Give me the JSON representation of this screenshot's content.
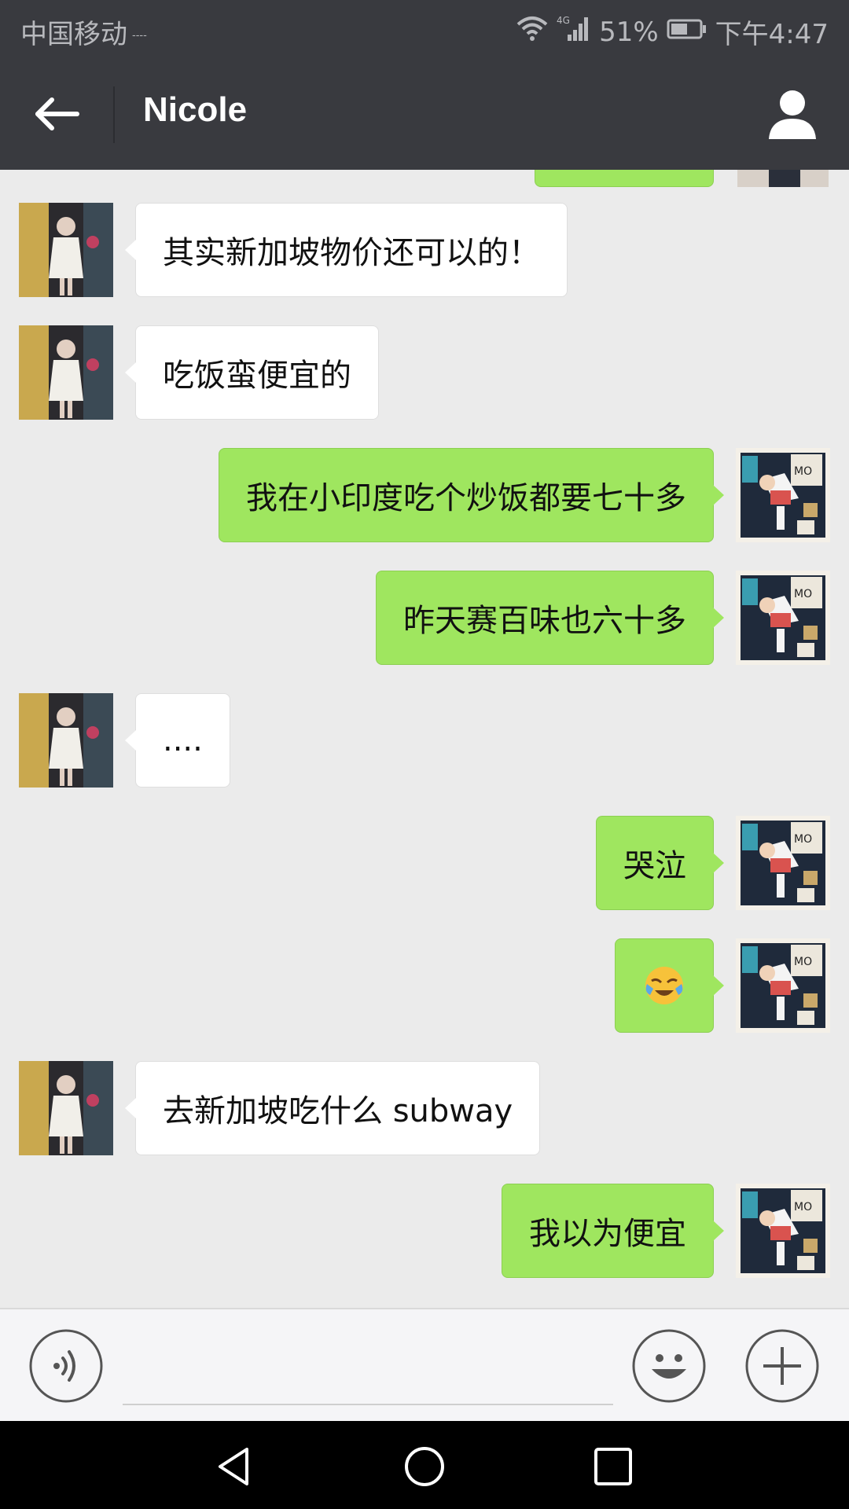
{
  "status_bar": {
    "carrier": "中国移动",
    "carrier_extra": "----",
    "network": "4G",
    "battery": "51%",
    "time": "下午4:47"
  },
  "header": {
    "title": "Nicole",
    "back_icon": "arrow-left-icon",
    "profile_icon": "person-icon"
  },
  "messages": [
    {
      "side": "left",
      "text": "其实新加坡物价还可以的！"
    },
    {
      "side": "left",
      "text": "吃饭蛮便宜的"
    },
    {
      "side": "right",
      "text": "我在小印度吃个炒饭都要七十多"
    },
    {
      "side": "right",
      "text": "昨天赛百味也六十多"
    },
    {
      "side": "left",
      "text": "...."
    },
    {
      "side": "right",
      "text": "哭泣"
    },
    {
      "side": "right",
      "text": "😭",
      "type": "emoji",
      "icon": "crying-laughing-emoji-icon"
    },
    {
      "side": "left",
      "text": "去新加坡吃什么 subway"
    },
    {
      "side": "right",
      "text": "我以为便宜"
    }
  ],
  "input_bar": {
    "placeholder": "",
    "voice_icon": "voice-icon",
    "emoji_icon": "smiley-icon",
    "plus_icon": "plus-icon"
  },
  "nav_bar": {
    "back_icon": "triangle-back-icon",
    "home_icon": "circle-home-icon",
    "recent_icon": "square-recent-icon"
  },
  "colors": {
    "header_bg": "#393a3f",
    "chat_bg": "#ebebeb",
    "own_bubble": "#9fe65f",
    "other_bubble": "#ffffff"
  }
}
